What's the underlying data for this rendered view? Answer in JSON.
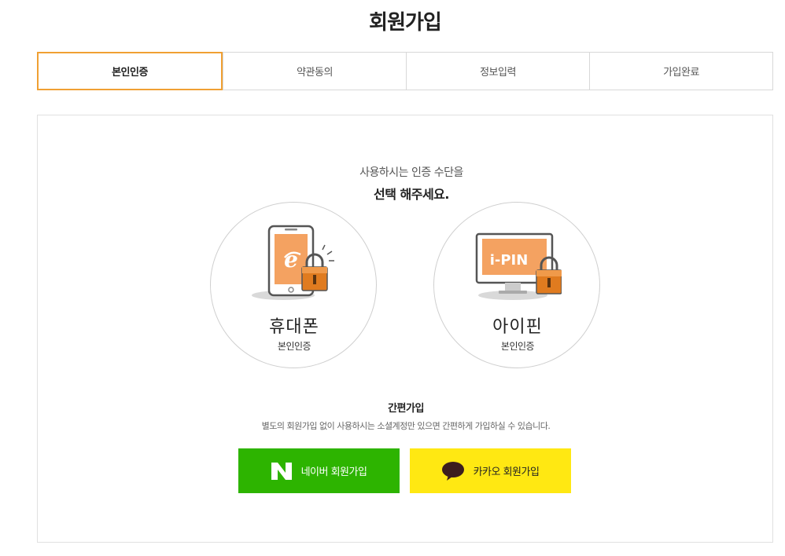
{
  "page": {
    "title": "회원가입"
  },
  "steps": [
    {
      "label": "본인인증",
      "active": true
    },
    {
      "label": "약관동의",
      "active": false
    },
    {
      "label": "정보입력",
      "active": false
    },
    {
      "label": "가입완료",
      "active": false
    }
  ],
  "intro": {
    "line1": "사용하시는 인증 수단을",
    "line2": "선택 해주세요."
  },
  "auth_options": {
    "phone": {
      "title": "휴대폰",
      "subtitle": "본인인증",
      "icon": "phone-lock-icon"
    },
    "ipin": {
      "title": "아이핀",
      "subtitle": "본인인증",
      "icon": "ipin-monitor-lock-icon",
      "screen_text": "i-PIN"
    }
  },
  "simple_signup": {
    "title": "간편가입",
    "description": "별도의 회원가입 없이 사용하시는 소셜계정만 있으면 간편하게 가입하실 수 있습니다.",
    "naver": {
      "label": "네이버 회원가입",
      "icon_letter": "N",
      "color": "#2db400"
    },
    "kakao": {
      "label": "카카오 회원가입",
      "icon": "speech-bubble-icon",
      "color": "#ffe812"
    }
  },
  "colors": {
    "active_step_border": "#f0a033",
    "icon_orange": "#f4a261",
    "lock_orange": "#e07b1f"
  }
}
